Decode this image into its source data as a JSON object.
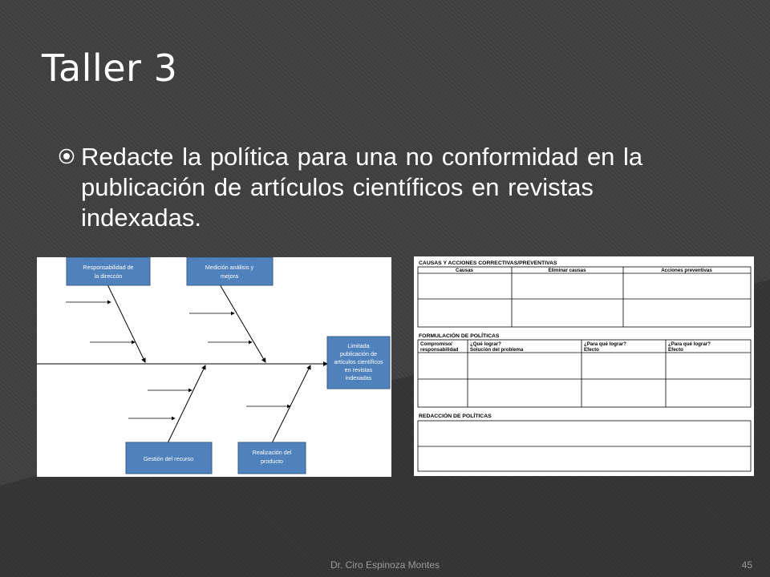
{
  "slide": {
    "title": "Taller 3",
    "bullet": "Redacte la política para una no conformidad en la publicación de artículos científicos en revistas indexadas."
  },
  "fishbone": {
    "categories": {
      "top_left": [
        "Responsabilidad de",
        "la direccón"
      ],
      "top_right": [
        "Medición análisis y",
        "mejora"
      ],
      "bottom_left": [
        "Gestión del recurso"
      ],
      "bottom_right": [
        "Realización del",
        "producto"
      ]
    },
    "effect": [
      "Limitada",
      "publicación de",
      "artículos científicos",
      "en revistas",
      "indexadas"
    ],
    "box_color": "#4f81bd"
  },
  "policy_form": {
    "section1": {
      "title": "CAUSAS Y ACCIONES CORRECTIVAS/PREVENTIVAS",
      "headers": [
        "Causas",
        "Eliminar causas",
        "Acciones preventivas"
      ]
    },
    "section2": {
      "title": "FORMULACIÓN DE POLÍTICAS",
      "headers": [
        [
          "Compromiso/",
          "responsabilidad"
        ],
        [
          "¿Qué lograr?",
          "Solución del problema"
        ],
        [
          "¿Para qué lograr?",
          "Efecto"
        ],
        [
          "¿Para qué lograr?",
          "Efecto"
        ]
      ]
    },
    "section3": {
      "title": "REDACCIÓN DE POLÍTICAS"
    }
  },
  "footer": {
    "author": "Dr. Ciro Espinoza Montes",
    "page": "45"
  }
}
